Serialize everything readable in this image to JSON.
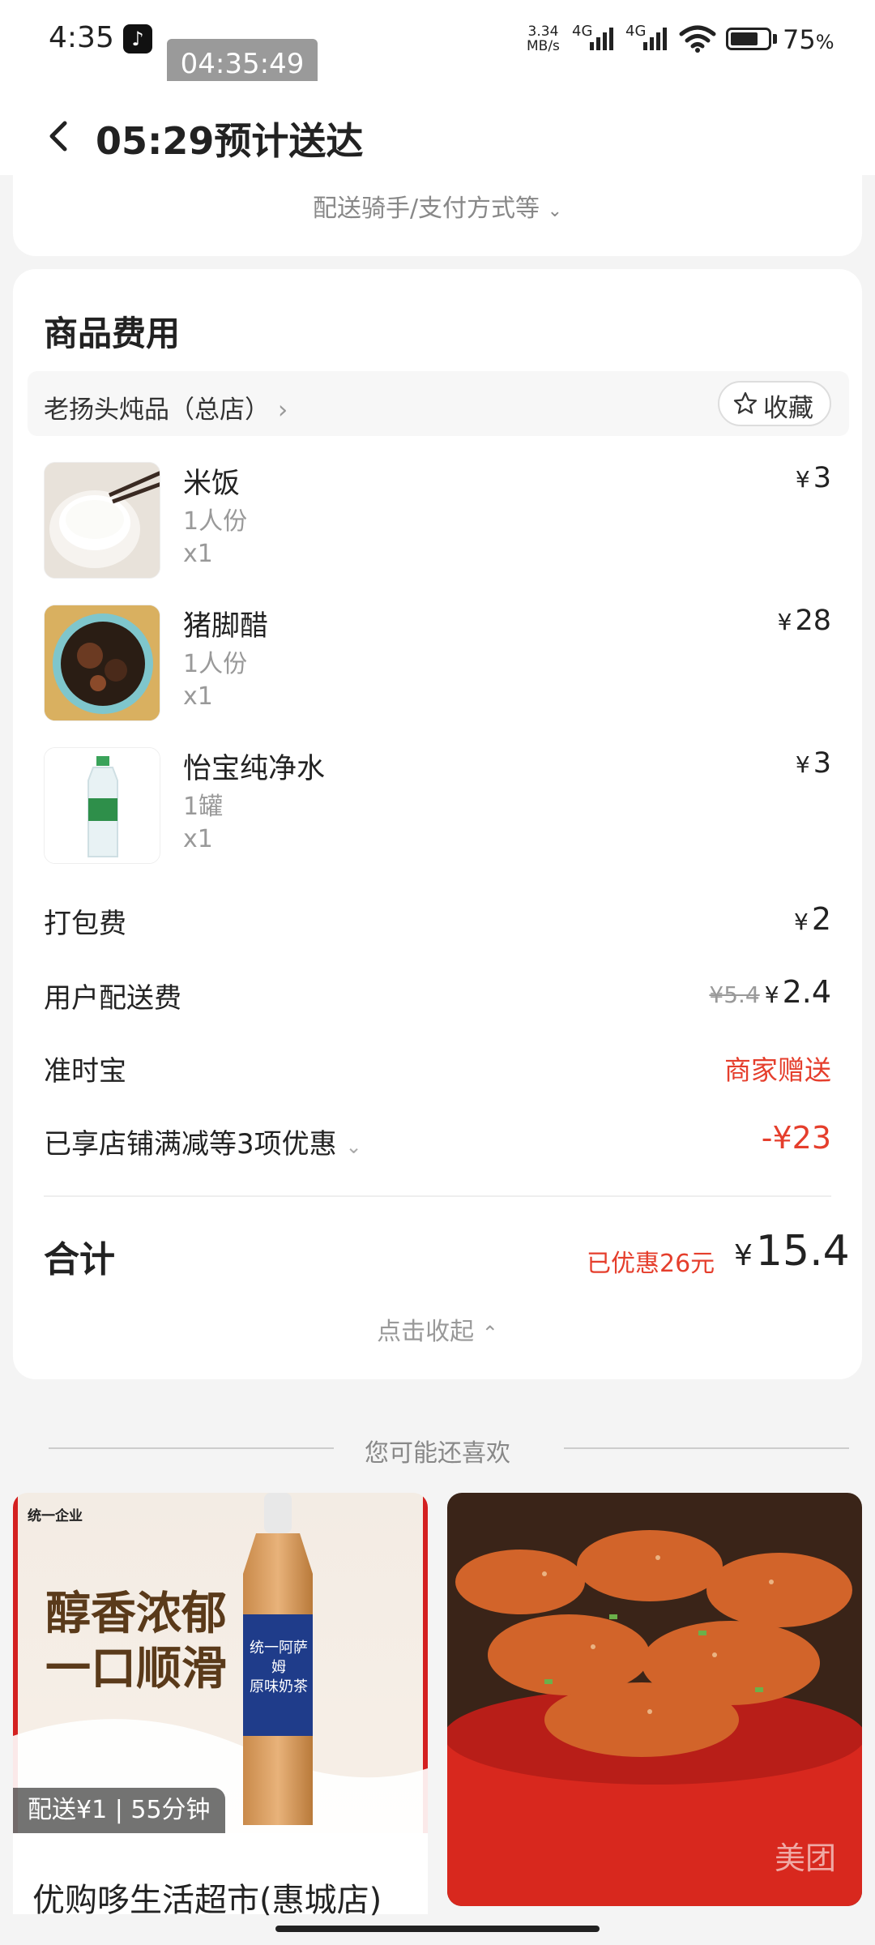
{
  "status_bar": {
    "time": "4:35",
    "app_icon": "tiktok-icon",
    "overlay_clock": "04:35:49",
    "net_speed_value": "3.34",
    "net_speed_unit": "MB/s",
    "signal1_label": "4G",
    "signal2_label": "4G",
    "battery_percent": "75",
    "battery_percent_sign": "%",
    "battery_level": 0.75
  },
  "header": {
    "title": "05:29预计送达",
    "back_icon": "back-arrow-icon"
  },
  "order_info": {
    "expand_label": "配送骑手/支付方式等"
  },
  "fees": {
    "section_title": "商品费用",
    "shop_name": "老扬头炖品（总店）",
    "favorite_label": "收藏",
    "currency": "¥",
    "items": [
      {
        "name": "米饭",
        "spec": "1人份",
        "qty": "x1",
        "price": "3"
      },
      {
        "name": "猪脚醋",
        "spec": "1人份",
        "qty": "x1",
        "price": "28"
      },
      {
        "name": "怡宝纯净水",
        "spec": "1罐",
        "qty": "x1",
        "price": "3"
      }
    ],
    "packing_label": "打包费",
    "packing_price": "2",
    "delivery_label": "用户配送费",
    "delivery_original": "¥5.4",
    "delivery_price": "2.4",
    "ontime_label": "准时宝",
    "ontime_value": "商家赠送",
    "discount_label": "已享店铺满减等3项优惠",
    "discount_value": "-¥23",
    "total_label": "合计",
    "saved_text": "已优惠26元",
    "total_price": "15.4",
    "collapse_label": "点击收起"
  },
  "recommend": {
    "title": "您可能还喜欢",
    "cards": [
      {
        "ad_brand": "统一企业",
        "ad_slogan_line1": "醇香浓郁",
        "ad_slogan_line2": "一口顺滑",
        "bottle_brand": "统一阿萨姆",
        "bottle_flavor": "原味奶茶",
        "delivery_badge": "配送¥1 | 55分钟",
        "store_name": "优购哆生活超市(惠城店)"
      },
      {
        "watermark": "美团"
      }
    ]
  },
  "colors": {
    "accent_red": "#e53e2c",
    "background": "#f4f4f4"
  }
}
